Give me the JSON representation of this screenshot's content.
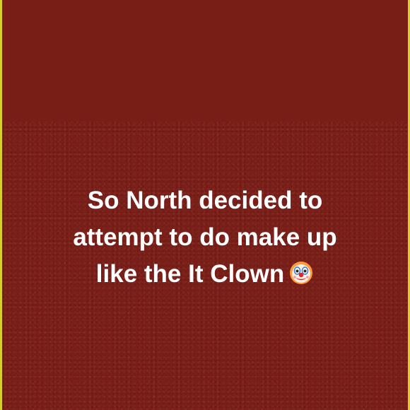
{
  "story": {
    "caption_lines": [
      "So North decided to",
      "attempt to do make up",
      "like the It Clown"
    ],
    "emoji": "clown-face-icon",
    "colors": {
      "background": "#7a1c16",
      "text": "#ffffff",
      "border": "#d8cf2a"
    }
  }
}
